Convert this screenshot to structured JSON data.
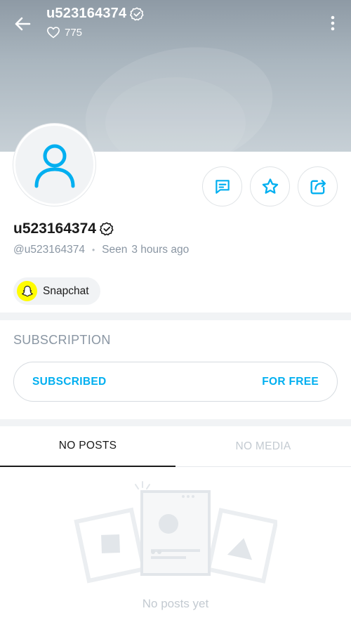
{
  "header": {
    "username": "u523164374",
    "likes_count": "775",
    "colors": {
      "cover_top": "#8e9aa5",
      "cover_bottom": "#c7d0d6"
    }
  },
  "profile": {
    "name": "u523164374",
    "handle": "@u523164374",
    "separator": "•",
    "seen_label": "Seen",
    "seen_time": "3 hours ago"
  },
  "actions": [
    {
      "name": "message",
      "icon": "message-icon"
    },
    {
      "name": "favorite",
      "icon": "star-icon"
    },
    {
      "name": "share",
      "icon": "share-icon"
    }
  ],
  "social": {
    "snapchat_label": "Snapchat"
  },
  "subscription": {
    "section_label": "SUBSCRIPTION",
    "status_label": "SUBSCRIBED",
    "price_label": "FOR FREE"
  },
  "tabs": [
    {
      "label": "NO POSTS",
      "active": true
    },
    {
      "label": "NO MEDIA",
      "active": false
    }
  ],
  "empty_state": {
    "text": "No posts yet"
  },
  "colors": {
    "accent": "#00aff0",
    "muted": "#8a96a3",
    "snapchat": "#fffc00"
  }
}
